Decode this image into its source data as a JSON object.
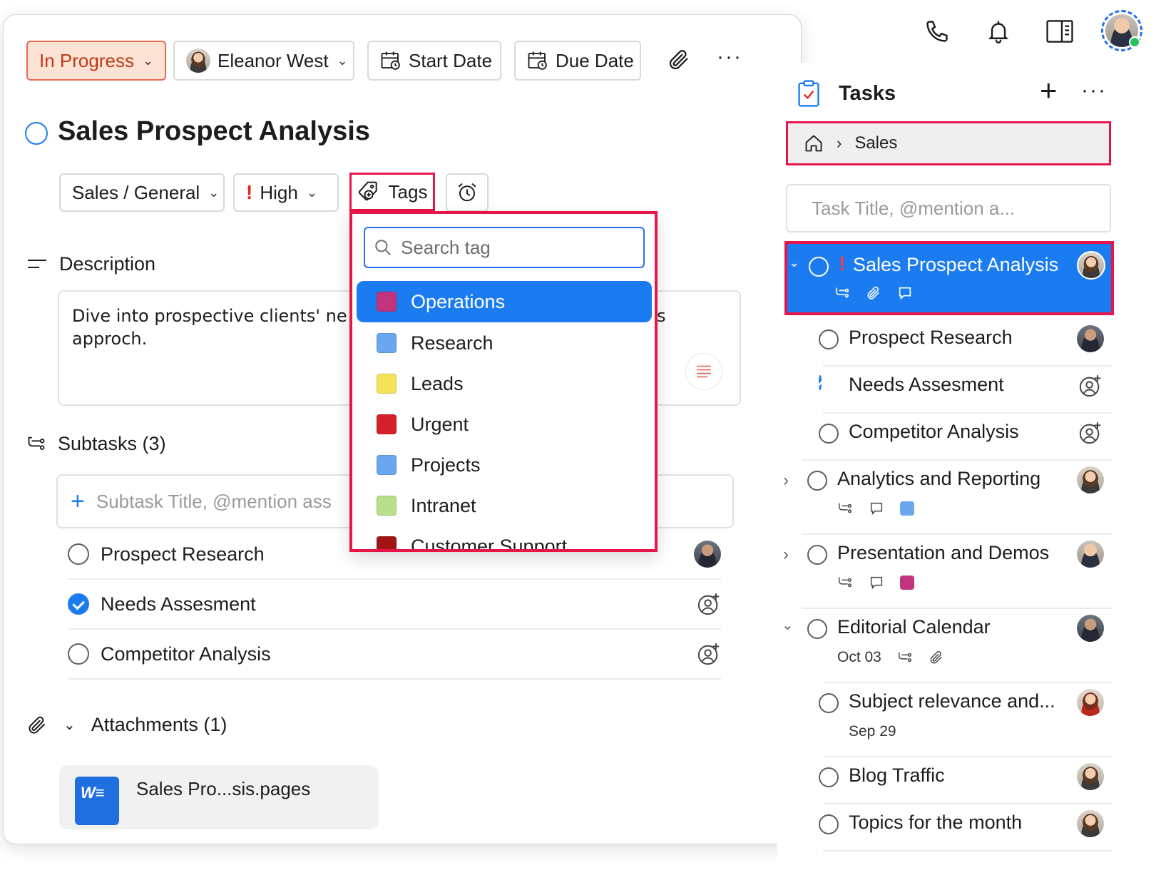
{
  "colors": {
    "accent": "#1a7cf0",
    "highlight_border": "#e8154a",
    "status_bg": "#fde3d6",
    "status_text": "#c03a16",
    "priority_red": "#e8241d"
  },
  "top_icons": [
    "phone-icon",
    "bell-icon",
    "sidebar-toggle-icon",
    "user-avatar"
  ],
  "task_panel": {
    "status": "In Progress",
    "assignee": "Eleanor West",
    "start_date_label": "Start Date",
    "due_date_label": "Due Date",
    "title": "Sales Prospect Analysis",
    "project": "Sales / General",
    "priority": "High",
    "priority_mark": "!",
    "tags_label": "Tags",
    "description_label": "Description",
    "description_text_line1": "Dive into prospective clients' ne",
    "description_text_line1_tail": "s",
    "description_text_line2": "approch.",
    "subtasks_label": "Subtasks (3)",
    "subtask_placeholder": "Subtask Title, @mention ass",
    "subtasks": [
      {
        "title": "Prospect Research",
        "done": false
      },
      {
        "title": "Needs Assesment",
        "done": true
      },
      {
        "title": "Competitor Analysis",
        "done": false
      }
    ],
    "attachments_label": "Attachments (1)",
    "attachment_name": "Sales Pro...sis.pages",
    "attachment_icon_text": "W"
  },
  "tag_dropdown": {
    "search_placeholder": "Search tag",
    "tags": [
      {
        "name": "Operations",
        "color": "#c2357e",
        "active": true
      },
      {
        "name": "Research",
        "color": "#6aa7ee",
        "active": false
      },
      {
        "name": "Leads",
        "color": "#f6e15a",
        "active": false
      },
      {
        "name": "Urgent",
        "color": "#d4202a",
        "active": false
      },
      {
        "name": "Projects",
        "color": "#6aa7ee",
        "active": false
      },
      {
        "name": "Intranet",
        "color": "#b6e08a",
        "active": false
      },
      {
        "name": "Customer Support",
        "color": "#a31515",
        "active": false
      }
    ]
  },
  "sidebar": {
    "title": "Tasks",
    "breadcrumb_current": "Sales",
    "task_input_placeholder": "Task Title, @mention a...",
    "selected_task": {
      "title": "Sales Prospect Analysis",
      "priority_mark": "!"
    },
    "tasks": [
      {
        "title": "Prospect Research",
        "done": false
      },
      {
        "title": "Needs Assesment",
        "done": true
      },
      {
        "title": "Competitor Analysis",
        "done": false
      },
      {
        "title": "Analytics and Reporting",
        "done": false,
        "tag_color": "#6aa7ee"
      },
      {
        "title": "Presentation and Demos",
        "done": false,
        "tag_color": "#c2357e"
      },
      {
        "title": "Editorial Calendar",
        "done": false,
        "date": "Oct 03"
      },
      {
        "title": "Subject relevance and...",
        "done": false,
        "date": "Sep 29"
      },
      {
        "title": "Blog Traffic",
        "done": false
      },
      {
        "title": "Topics for the month",
        "done": false
      }
    ]
  }
}
